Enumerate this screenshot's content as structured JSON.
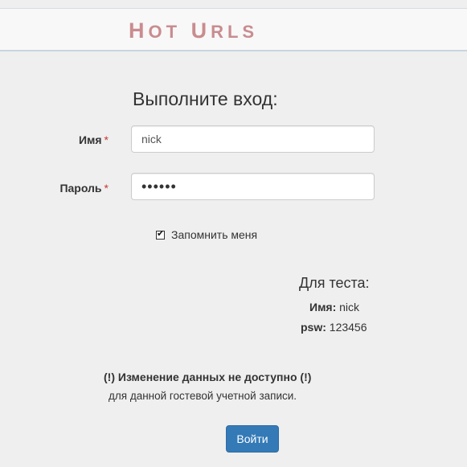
{
  "header": {
    "brand_first_initial": "H",
    "brand_first_rest": "OT",
    "brand_second_initial": "U",
    "brand_second_rest": "RLS",
    "brand_color": "#c98c8f"
  },
  "login_form": {
    "title": "Выполните вход:",
    "username_label": "Имя",
    "username_value": "nick",
    "password_label": "Пароль",
    "password_value": "••••••",
    "required_marker": "*",
    "remember_label": "Запомнить меня",
    "remember_checked": true,
    "submit_label": "Войти"
  },
  "test_credentials": {
    "title": "Для теста:",
    "name_label": "Имя:",
    "name_value": "nick",
    "password_label": "psw:",
    "password_value": "123456"
  },
  "notice": {
    "warning": "(!) Изменение данных не доступно (!)",
    "detail": "для данной гостевой учетной записи."
  },
  "colors": {
    "primary_button": "#337ab7",
    "required": "#cc3333"
  }
}
